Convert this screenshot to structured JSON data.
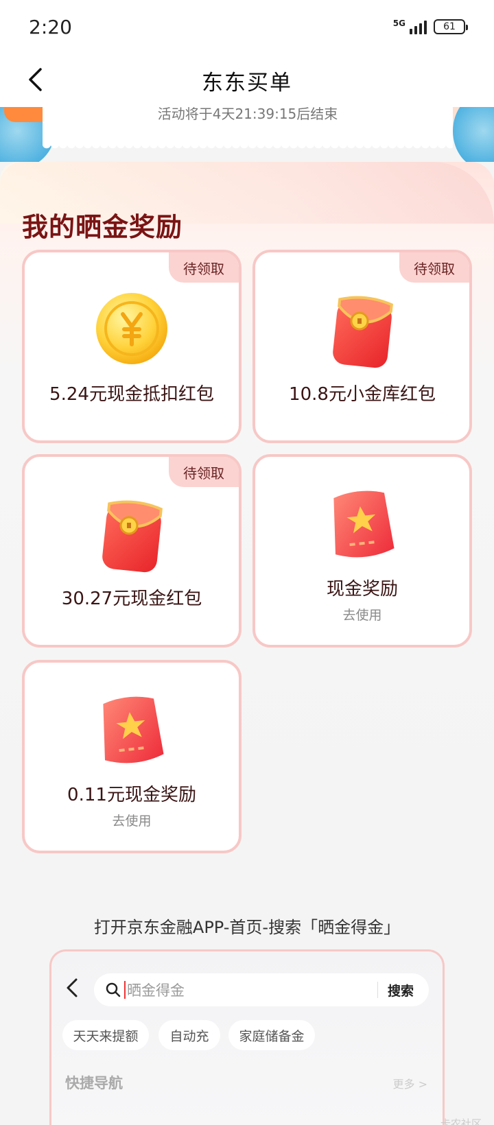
{
  "status_bar": {
    "time": "2:20",
    "network": "5G",
    "battery": "61"
  },
  "nav": {
    "title": "东东买单"
  },
  "ticket": {
    "countdown_text": "活动将于4天21:39:15后结束"
  },
  "section": {
    "title": "我的晒金奖励"
  },
  "cards": [
    {
      "label": "5.24元现金抵扣红包",
      "badge": "待领取",
      "icon": "gold-coin-icon"
    },
    {
      "label": "10.8元小金库红包",
      "badge": "待领取",
      "icon": "red-envelope-icon"
    },
    {
      "label": "30.27元现金红包",
      "badge": "待领取",
      "icon": "red-envelope-icon"
    },
    {
      "label": "现金奖励",
      "sub": "去使用",
      "icon": "star-pouch-icon"
    },
    {
      "label": "0.11元现金奖励",
      "sub": "去使用",
      "icon": "star-pouch-icon"
    }
  ],
  "instruction": "打开京东金融APP-首页-搜索「晒金得金」",
  "search_preview": {
    "placeholder": "晒金得金",
    "button": "搜索",
    "chips": [
      "天天来提额",
      "自动充",
      "家庭储备金"
    ],
    "nav_title": "快捷导航",
    "more": "更多 >"
  },
  "watermark": "卡农社区",
  "colors": {
    "accent": "#7a1414",
    "card_border": "#f7c8c6",
    "badge_bg": "#fbd3d1"
  }
}
